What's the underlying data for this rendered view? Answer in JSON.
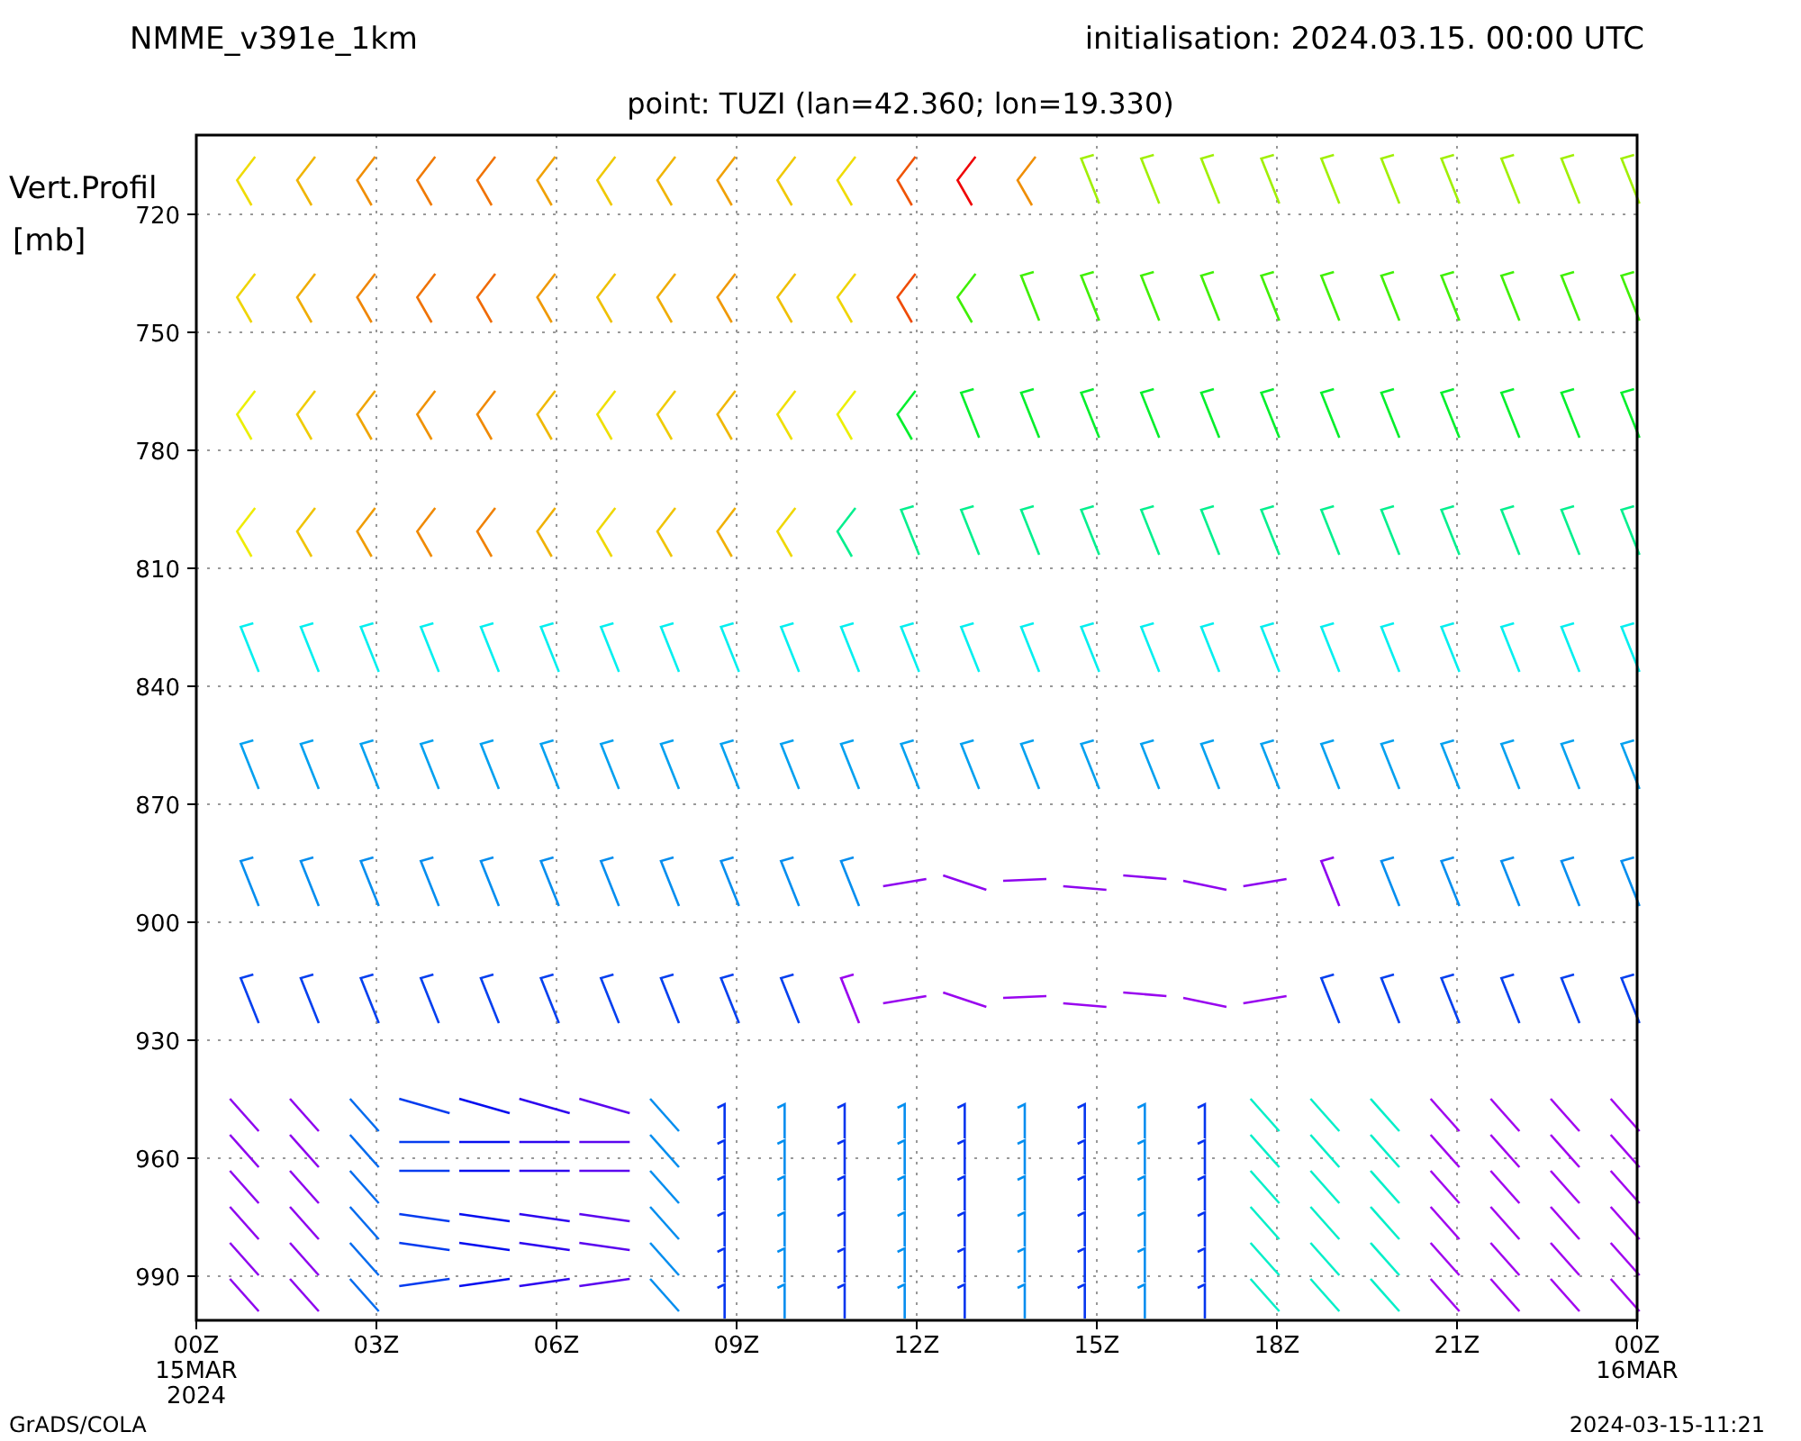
{
  "header": {
    "model": "NMME_v391e_1km",
    "initialisation": "initialisation: 2024.03.15. 00:00 UTC"
  },
  "subtitle": "point: TUZI (lan=42.360; lon=19.330)",
  "y_axis": {
    "label": "Vert.Profil",
    "unit": "[mb]",
    "ticks": [
      "720",
      "750",
      "780",
      "810",
      "840",
      "870",
      "900",
      "930",
      "960",
      "990"
    ]
  },
  "x_axis": {
    "ticks": [
      {
        "label": "00Z",
        "date": "15MAR",
        "year": "2024"
      },
      {
        "label": "03Z"
      },
      {
        "label": "06Z"
      },
      {
        "label": "09Z"
      },
      {
        "label": "12Z"
      },
      {
        "label": "15Z"
      },
      {
        "label": "18Z"
      },
      {
        "label": "21Z"
      },
      {
        "label": "00Z",
        "date": "16MAR"
      }
    ]
  },
  "footer": {
    "left": "GrADS/COLA",
    "right": "2024-03-15-11:21"
  }
}
